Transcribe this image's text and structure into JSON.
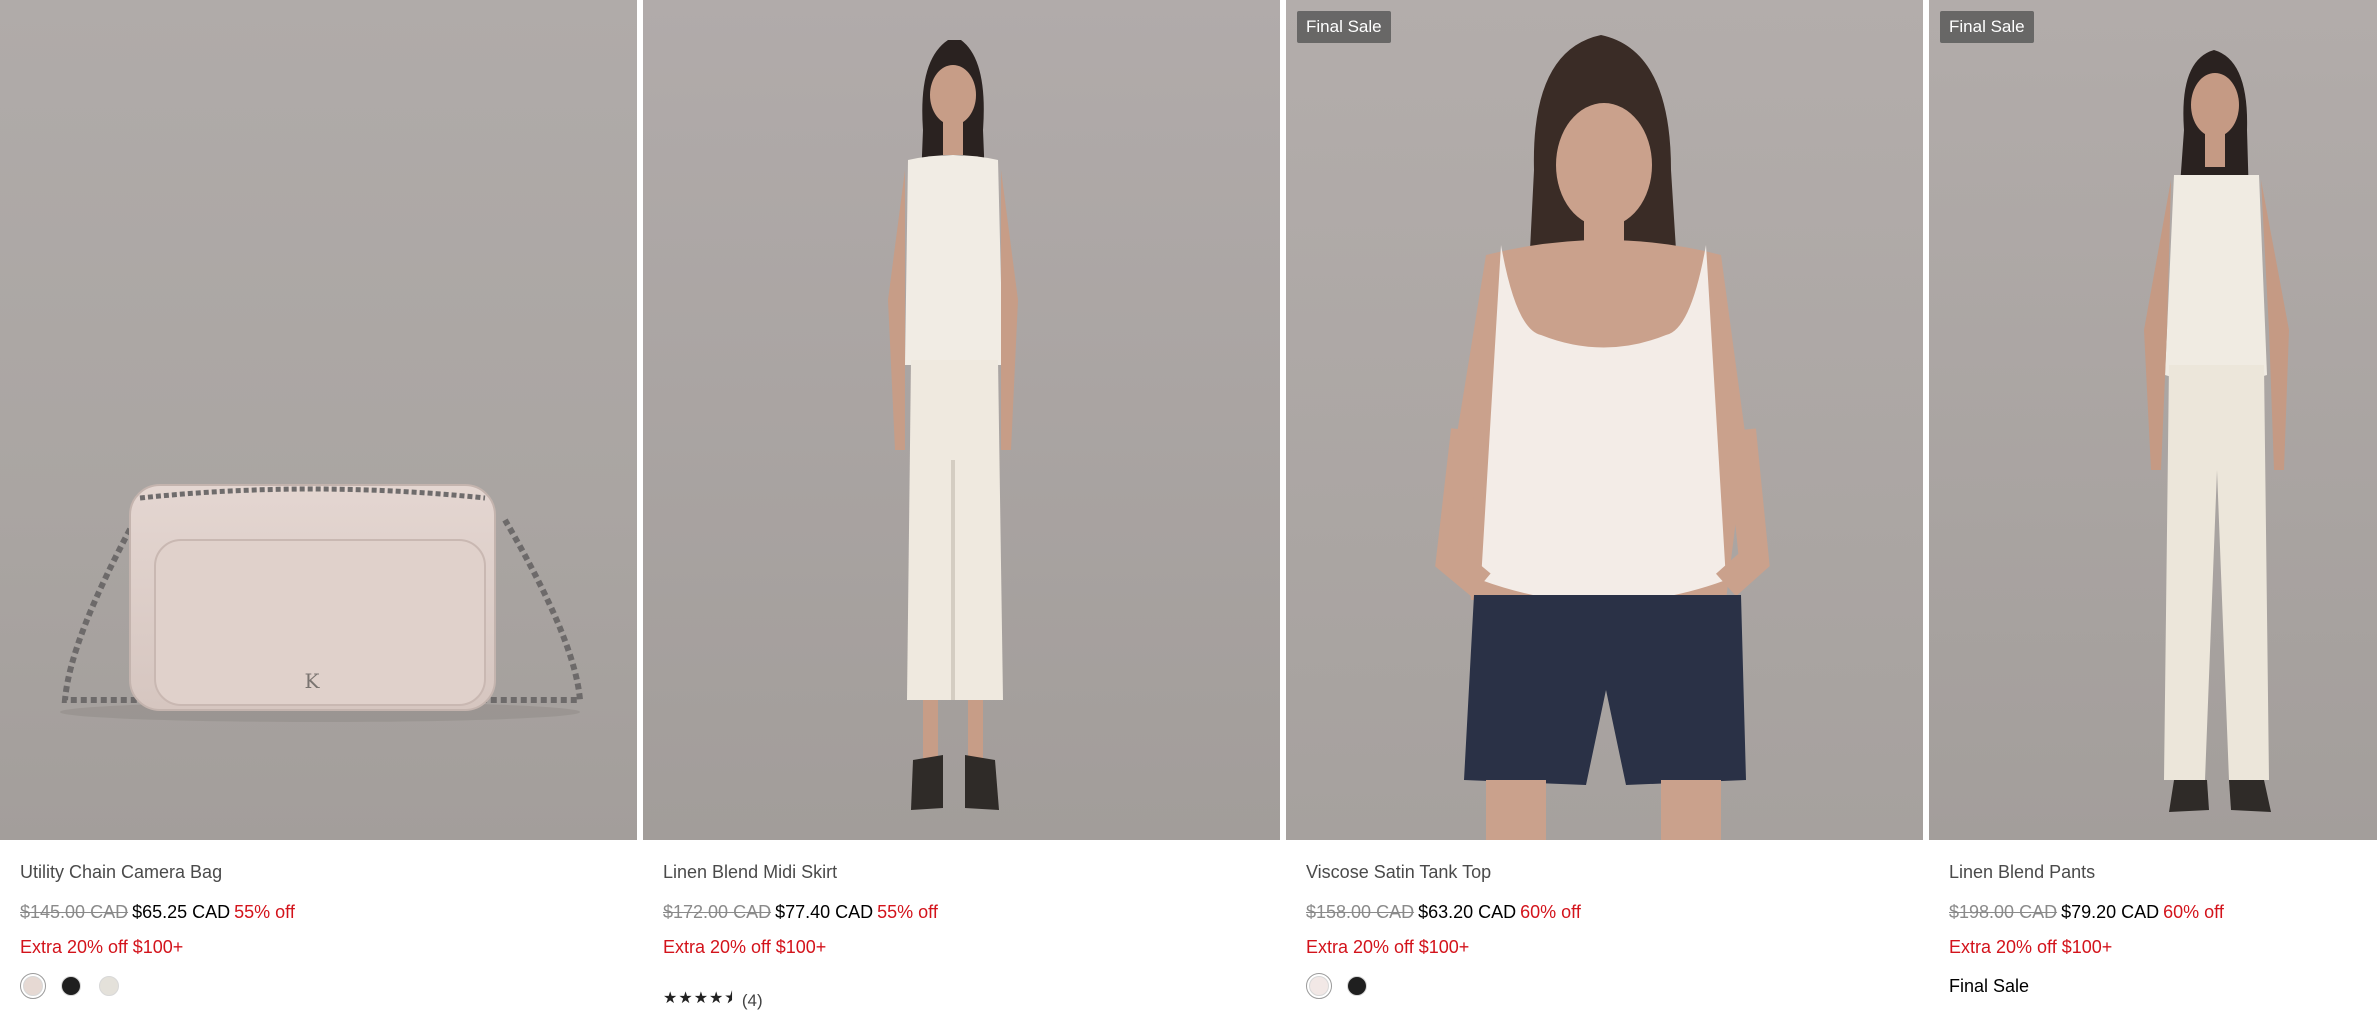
{
  "products": [
    {
      "name": "Utility Chain Camera Bag",
      "original_price": "$145.00 CAD",
      "sale_price": "$65.25 CAD",
      "discount": "55% off",
      "promo": "Extra 20% off $100+",
      "badge": "",
      "swatches": [
        "#e6d9d3",
        "#1f1f1f",
        "#e4e1da"
      ],
      "image": "camera-bag-photo"
    },
    {
      "name": "Linen Blend Midi Skirt",
      "original_price": "$172.00 CAD",
      "sale_price": "$77.40 CAD",
      "discount": "55% off",
      "promo": "Extra 20% off $100+",
      "badge": "",
      "rating_stars": "★★★★★",
      "rating_count": "(4)",
      "rating_value": 4.5,
      "image": "model-midi-skirt-photo"
    },
    {
      "name": "Viscose Satin Tank Top",
      "original_price": "$158.00 CAD",
      "sale_price": "$63.20 CAD",
      "discount": "60% off",
      "promo": "Extra 20% off $100+",
      "badge": "Final Sale",
      "swatches": [
        "#f2e8e6",
        "#1f1f1f"
      ],
      "image": "model-tank-top-photo"
    },
    {
      "name": "Linen Blend Pants",
      "original_price": "$198.00 CAD",
      "sale_price": "$79.20 CAD",
      "discount": "60% off",
      "promo": "Extra 20% off $100+",
      "badge": "Final Sale",
      "final_sale_label": "Final Sale",
      "image": "model-linen-pants-photo"
    }
  ],
  "colors": {
    "discount_red": "#d3131b",
    "badge_bg": "#5a5a5a",
    "photo_bg": "#aca6a4"
  }
}
